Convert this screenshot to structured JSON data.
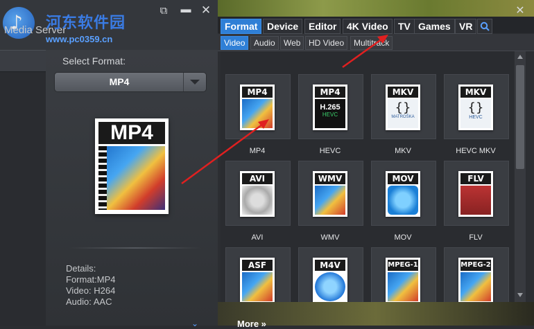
{
  "watermark": {
    "title": "河东软件园",
    "url": "www.pc0359.cn"
  },
  "app": {
    "title": "Media Server"
  },
  "left_panel": {
    "select_label": "Select Format:",
    "selected_format": "MP4",
    "preview_label": "MP4",
    "details": {
      "heading": "Details:",
      "format": "Format:MP4",
      "video": "Video: H264",
      "audio": "Audio: AAC"
    }
  },
  "dialog": {
    "tabs": [
      {
        "label": "Format",
        "active": true
      },
      {
        "label": "Device"
      },
      {
        "label": "Editor"
      },
      {
        "label": "4K Video"
      },
      {
        "label": "TV"
      },
      {
        "label": "Games"
      },
      {
        "label": "VR"
      }
    ],
    "subtabs": [
      {
        "label": "Video",
        "active": true
      },
      {
        "label": "Audio"
      },
      {
        "label": "Web"
      },
      {
        "label": "HD Video"
      },
      {
        "label": "Multitrack"
      }
    ],
    "formats": [
      {
        "badge": "MP4",
        "label": "MP4",
        "art": "mp4"
      },
      {
        "badge": "MP4",
        "label": "HEVC",
        "art": "hevc",
        "sub": "H.265"
      },
      {
        "badge": "MKV",
        "label": "MKV",
        "art": "mkv",
        "sub": "MATROŠKA"
      },
      {
        "badge": "MKV",
        "label": "HEVC MKV",
        "art": "mkv",
        "sub": "HEVC"
      },
      {
        "badge": "AVI",
        "label": "AVI",
        "art": "avi"
      },
      {
        "badge": "WMV",
        "label": "WMV",
        "art": "wmv"
      },
      {
        "badge": "MOV",
        "label": "MOV",
        "art": "mov"
      },
      {
        "badge": "FLV",
        "label": "FLV",
        "art": "flv"
      },
      {
        "badge": "ASF",
        "label": "",
        "art": "asf"
      },
      {
        "badge": "M4V",
        "label": "",
        "art": "m4v"
      },
      {
        "badge": "MPEG-1",
        "label": "",
        "art": "asf"
      },
      {
        "badge": "MPEG-2",
        "label": "",
        "art": "asf"
      }
    ],
    "more_label": "More »"
  }
}
